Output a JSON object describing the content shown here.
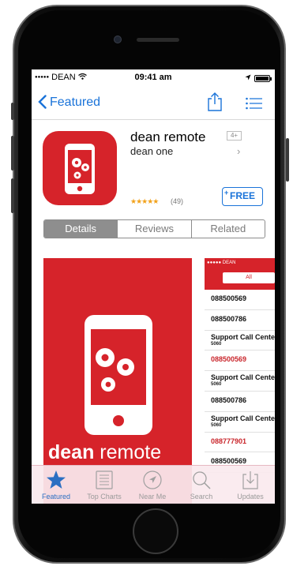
{
  "status_bar": {
    "carrier": "DEAN",
    "time": "09:41 am"
  },
  "nav": {
    "back_label": "Featured",
    "back_icon": "chevron-left-icon",
    "share_icon": "share-icon",
    "list_icon": "list-icon"
  },
  "app": {
    "name": "dean remote",
    "developer": "dean one",
    "age_rating": "4+",
    "stars": "★★★★★",
    "rating_count": "(49)",
    "price_button": "FREE",
    "price_plus": "+"
  },
  "segments": [
    {
      "label": "Details",
      "active": true
    },
    {
      "label": "Reviews",
      "active": false
    },
    {
      "label": "Related",
      "active": false
    }
  ],
  "screenshot1": {
    "brand_bold": "dean",
    "brand_light": " remote"
  },
  "screenshot2": {
    "status": "●●●●● DEAN",
    "tab": "All",
    "items": [
      {
        "text": "088500569",
        "sub": ""
      },
      {
        "text": "088500786",
        "sub": ""
      },
      {
        "text": "Support Call Center",
        "sub": "5060"
      },
      {
        "text": "088500569",
        "sub": ""
      },
      {
        "text": "Support Call Center",
        "sub": "5060"
      },
      {
        "text": "088500786",
        "sub": ""
      },
      {
        "text": "Support Call Center",
        "sub": "5060"
      },
      {
        "text": "088777901",
        "sub": ""
      },
      {
        "text": "088500569",
        "sub": ""
      }
    ]
  },
  "tab_bar": {
    "items": [
      {
        "label": "Featured",
        "icon": "star-icon",
        "active": true
      },
      {
        "label": "Top Charts",
        "icon": "top-charts-icon",
        "active": false
      },
      {
        "label": "Near Me",
        "icon": "location-icon",
        "active": false
      },
      {
        "label": "Search",
        "icon": "search-icon",
        "active": false
      },
      {
        "label": "Updates",
        "icon": "updates-icon",
        "active": false
      }
    ]
  },
  "colors": {
    "brand_red": "#d6232a",
    "ios_blue": "#1a73d9"
  }
}
